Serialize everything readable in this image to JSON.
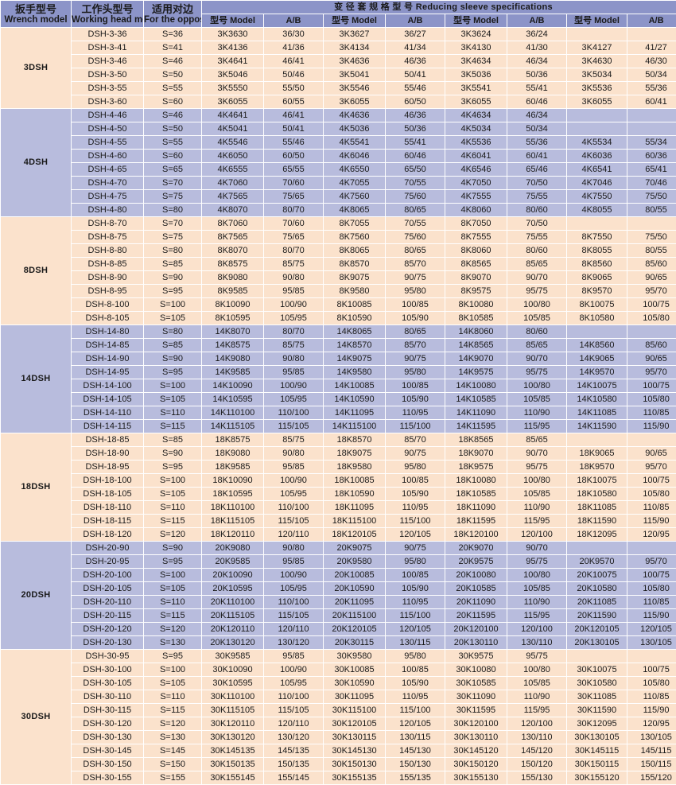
{
  "table": {
    "headers": {
      "wrench_model_cn": "扳手型号",
      "wrench_model_en": "Wrench model",
      "working_head_cn": "工作头型号",
      "working_head_en": "Working head model",
      "opposite_cn": "适用对边",
      "opposite_en": "For the opposite",
      "sleeve_group": "变 径 套 规 格 型 号  Reducing sleeve specifications",
      "model": "型号 Model",
      "ab": "A/B"
    },
    "colors": {
      "header_bg": "#8c94c8",
      "header_text": "#ffffff",
      "row_peach": "#fbe2cc",
      "row_lavender": "#b8bcdd",
      "grid": "#ffffff",
      "text": "#1a1a1a"
    },
    "groups": [
      {
        "label": "3DSH",
        "shade": "peach",
        "rows": [
          {
            "wrench": "DSH-3-36",
            "opposite": "S=36",
            "s1m": "3K3630",
            "s1ab": "36/30",
            "s2m": "3K3627",
            "s2ab": "36/27",
            "s3m": "3K3624",
            "s3ab": "36/24",
            "s4m": "",
            "s4ab": ""
          },
          {
            "wrench": "DSH-3-41",
            "opposite": "S=41",
            "s1m": "3K4136",
            "s1ab": "41/36",
            "s2m": "3K4134",
            "s2ab": "41/34",
            "s3m": "3K4130",
            "s3ab": "41/30",
            "s4m": "3K4127",
            "s4ab": "41/27"
          },
          {
            "wrench": "DSH-3-46",
            "opposite": "S=46",
            "s1m": "3K4641",
            "s1ab": "46/41",
            "s2m": "3K4636",
            "s2ab": "46/36",
            "s3m": "3K4634",
            "s3ab": "46/34",
            "s4m": "3K4630",
            "s4ab": "46/30"
          },
          {
            "wrench": "DSH-3-50",
            "opposite": "S=50",
            "s1m": "3K5046",
            "s1ab": "50/46",
            "s2m": "3K5041",
            "s2ab": "50/41",
            "s3m": "3K5036",
            "s3ab": "50/36",
            "s4m": "3K5034",
            "s4ab": "50/34"
          },
          {
            "wrench": "DSH-3-55",
            "opposite": "S=55",
            "s1m": "3K5550",
            "s1ab": "55/50",
            "s2m": "3K5546",
            "s2ab": "55/46",
            "s3m": "3K5541",
            "s3ab": "55/41",
            "s4m": "3K5536",
            "s4ab": "55/36"
          },
          {
            "wrench": "DSH-3-60",
            "opposite": "S=60",
            "s1m": "3K6055",
            "s1ab": "60/55",
            "s2m": "3K6055",
            "s2ab": "60/50",
            "s3m": "3K6055",
            "s3ab": "60/46",
            "s4m": "3K6055",
            "s4ab": "60/41"
          }
        ]
      },
      {
        "label": "4DSH",
        "shade": "lav",
        "rows": [
          {
            "wrench": "DSH-4-46",
            "opposite": "S=46",
            "s1m": "4K4641",
            "s1ab": "46/41",
            "s2m": "4K4636",
            "s2ab": "46/36",
            "s3m": "4K4634",
            "s3ab": "46/34",
            "s4m": "",
            "s4ab": ""
          },
          {
            "wrench": "DSH-4-50",
            "opposite": "S=50",
            "s1m": "4K5041",
            "s1ab": "50/41",
            "s2m": "4K5036",
            "s2ab": "50/36",
            "s3m": "4K5034",
            "s3ab": "50/34",
            "s4m": "",
            "s4ab": ""
          },
          {
            "wrench": "DSH-4-55",
            "opposite": "S=55",
            "s1m": "4K5546",
            "s1ab": "55/46",
            "s2m": "4K5541",
            "s2ab": "55/41",
            "s3m": "4K5536",
            "s3ab": "55/36",
            "s4m": "4K5534",
            "s4ab": "55/34"
          },
          {
            "wrench": "DSH-4-60",
            "opposite": "S=60",
            "s1m": "4K6050",
            "s1ab": "60/50",
            "s2m": "4K6046",
            "s2ab": "60/46",
            "s3m": "4K6041",
            "s3ab": "60/41",
            "s4m": "4K6036",
            "s4ab": "60/36"
          },
          {
            "wrench": "DSH-4-65",
            "opposite": "S=65",
            "s1m": "4K6555",
            "s1ab": "65/55",
            "s2m": "4K6550",
            "s2ab": "65/50",
            "s3m": "4K6546",
            "s3ab": "65/46",
            "s4m": "4K6541",
            "s4ab": "65/41"
          },
          {
            "wrench": "DSH-4-70",
            "opposite": "S=70",
            "s1m": "4K7060",
            "s1ab": "70/60",
            "s2m": "4K7055",
            "s2ab": "70/55",
            "s3m": "4K7050",
            "s3ab": "70/50",
            "s4m": "4K7046",
            "s4ab": "70/46"
          },
          {
            "wrench": "DSH-4-75",
            "opposite": "S=75",
            "s1m": "4K7565",
            "s1ab": "75/65",
            "s2m": "4K7560",
            "s2ab": "75/60",
            "s3m": "4K7555",
            "s3ab": "75/55",
            "s4m": "4K7550",
            "s4ab": "75/50"
          },
          {
            "wrench": "DSH-4-80",
            "opposite": "S=80",
            "s1m": "4K8070",
            "s1ab": "80/70",
            "s2m": "4K8065",
            "s2ab": "80/65",
            "s3m": "4K8060",
            "s3ab": "80/60",
            "s4m": "4K8055",
            "s4ab": "80/55"
          }
        ]
      },
      {
        "label": "8DSH",
        "shade": "peach",
        "rows": [
          {
            "wrench": "DSH-8-70",
            "opposite": "S=70",
            "s1m": "8K7060",
            "s1ab": "70/60",
            "s2m": "8K7055",
            "s2ab": "70/55",
            "s3m": "8K7050",
            "s3ab": "70/50",
            "s4m": "",
            "s4ab": ""
          },
          {
            "wrench": "DSH-8-75",
            "opposite": "S=75",
            "s1m": "8K7565",
            "s1ab": "75/65",
            "s2m": "8K7560",
            "s2ab": "75/60",
            "s3m": "8K7555",
            "s3ab": "75/55",
            "s4m": "8K7550",
            "s4ab": "75/50"
          },
          {
            "wrench": "DSH-8-80",
            "opposite": "S=80",
            "s1m": "8K8070",
            "s1ab": "80/70",
            "s2m": "8K8065",
            "s2ab": "80/65",
            "s3m": "8K8060",
            "s3ab": "80/60",
            "s4m": "8K8055",
            "s4ab": "80/55"
          },
          {
            "wrench": "DSH-8-85",
            "opposite": "S=85",
            "s1m": "8K8575",
            "s1ab": "85/75",
            "s2m": "8K8570",
            "s2ab": "85/70",
            "s3m": "8K8565",
            "s3ab": "85/65",
            "s4m": "8K8560",
            "s4ab": "85/60"
          },
          {
            "wrench": "DSH-8-90",
            "opposite": "S=90",
            "s1m": "8K9080",
            "s1ab": "90/80",
            "s2m": "8K9075",
            "s2ab": "90/75",
            "s3m": "8K9070",
            "s3ab": "90/70",
            "s4m": "8K9065",
            "s4ab": "90/65"
          },
          {
            "wrench": "DSH-8-95",
            "opposite": "S=95",
            "s1m": "8K9585",
            "s1ab": "95/85",
            "s2m": "8K9580",
            "s2ab": "95/80",
            "s3m": "8K9575",
            "s3ab": "95/75",
            "s4m": "8K9570",
            "s4ab": "95/70"
          },
          {
            "wrench": "DSH-8-100",
            "opposite": "S=100",
            "s1m": "8K10090",
            "s1ab": "100/90",
            "s2m": "8K10085",
            "s2ab": "100/85",
            "s3m": "8K10080",
            "s3ab": "100/80",
            "s4m": "8K10075",
            "s4ab": "100/75"
          },
          {
            "wrench": "DSH-8-105",
            "opposite": "S=105",
            "s1m": "8K10595",
            "s1ab": "105/95",
            "s2m": "8K10590",
            "s2ab": "105/90",
            "s3m": "8K10585",
            "s3ab": "105/85",
            "s4m": "8K10580",
            "s4ab": "105/80"
          }
        ]
      },
      {
        "label": "14DSH",
        "shade": "lav",
        "rows": [
          {
            "wrench": "DSH-14-80",
            "opposite": "S=80",
            "s1m": "14K8070",
            "s1ab": "80/70",
            "s2m": "14K8065",
            "s2ab": "80/65",
            "s3m": "14K8060",
            "s3ab": "80/60",
            "s4m": "",
            "s4ab": ""
          },
          {
            "wrench": "DSH-14-85",
            "opposite": "S=85",
            "s1m": "14K8575",
            "s1ab": "85/75",
            "s2m": "14K8570",
            "s2ab": "85/70",
            "s3m": "14K8565",
            "s3ab": "85/65",
            "s4m": "14K8560",
            "s4ab": "85/60"
          },
          {
            "wrench": "DSH-14-90",
            "opposite": "S=90",
            "s1m": "14K9080",
            "s1ab": "90/80",
            "s2m": "14K9075",
            "s2ab": "90/75",
            "s3m": "14K9070",
            "s3ab": "90/70",
            "s4m": "14K9065",
            "s4ab": "90/65"
          },
          {
            "wrench": "DSH-14-95",
            "opposite": "S=95",
            "s1m": "14K9585",
            "s1ab": "95/85",
            "s2m": "14K9580",
            "s2ab": "95/80",
            "s3m": "14K9575",
            "s3ab": "95/75",
            "s4m": "14K9570",
            "s4ab": "95/70"
          },
          {
            "wrench": "DSH-14-100",
            "opposite": "S=100",
            "s1m": "14K10090",
            "s1ab": "100/90",
            "s2m": "14K10085",
            "s2ab": "100/85",
            "s3m": "14K10080",
            "s3ab": "100/80",
            "s4m": "14K10075",
            "s4ab": "100/75"
          },
          {
            "wrench": "DSH-14-105",
            "opposite": "S=105",
            "s1m": "14K10595",
            "s1ab": "105/95",
            "s2m": "14K10590",
            "s2ab": "105/90",
            "s3m": "14K10585",
            "s3ab": "105/85",
            "s4m": "14K10580",
            "s4ab": "105/80"
          },
          {
            "wrench": "DSH-14-110",
            "opposite": "S=110",
            "s1m": "14K110100",
            "s1ab": "110/100",
            "s2m": "14K11095",
            "s2ab": "110/95",
            "s3m": "14K11090",
            "s3ab": "110/90",
            "s4m": "14K11085",
            "s4ab": "110/85"
          },
          {
            "wrench": "DSH-14-115",
            "opposite": "S=115",
            "s1m": "14K115105",
            "s1ab": "115/105",
            "s2m": "14K115100",
            "s2ab": "115/100",
            "s3m": "14K11595",
            "s3ab": "115/95",
            "s4m": "14K11590",
            "s4ab": "115/90"
          }
        ]
      },
      {
        "label": "18DSH",
        "shade": "peach",
        "rows": [
          {
            "wrench": "DSH-18-85",
            "opposite": "S=85",
            "s1m": "18K8575",
            "s1ab": "85/75",
            "s2m": "18K8570",
            "s2ab": "85/70",
            "s3m": "18K8565",
            "s3ab": "85/65",
            "s4m": "",
            "s4ab": ""
          },
          {
            "wrench": "DSH-18-90",
            "opposite": "S=90",
            "s1m": "18K9080",
            "s1ab": "90/80",
            "s2m": "18K9075",
            "s2ab": "90/75",
            "s3m": "18K9070",
            "s3ab": "90/70",
            "s4m": "18K9065",
            "s4ab": "90/65"
          },
          {
            "wrench": "DSH-18-95",
            "opposite": "S=95",
            "s1m": "18K9585",
            "s1ab": "95/85",
            "s2m": "18K9580",
            "s2ab": "95/80",
            "s3m": "18K9575",
            "s3ab": "95/75",
            "s4m": "18K9570",
            "s4ab": "95/70"
          },
          {
            "wrench": "DSH-18-100",
            "opposite": "S=100",
            "s1m": "18K10090",
            "s1ab": "100/90",
            "s2m": "18K10085",
            "s2ab": "100/85",
            "s3m": "18K10080",
            "s3ab": "100/80",
            "s4m": "18K10075",
            "s4ab": "100/75"
          },
          {
            "wrench": "DSH-18-105",
            "opposite": "S=105",
            "s1m": "18K10595",
            "s1ab": "105/95",
            "s2m": "18K10590",
            "s2ab": "105/90",
            "s3m": "18K10585",
            "s3ab": "105/85",
            "s4m": "18K10580",
            "s4ab": "105/80"
          },
          {
            "wrench": "DSH-18-110",
            "opposite": "S=110",
            "s1m": "18K110100",
            "s1ab": "110/100",
            "s2m": "18K11095",
            "s2ab": "110/95",
            "s3m": "18K11090",
            "s3ab": "110/90",
            "s4m": "18K11085",
            "s4ab": "110/85"
          },
          {
            "wrench": "DSH-18-115",
            "opposite": "S=115",
            "s1m": "18K115105",
            "s1ab": "115/105",
            "s2m": "18K115100",
            "s2ab": "115/100",
            "s3m": "18K11595",
            "s3ab": "115/95",
            "s4m": "18K11590",
            "s4ab": "115/90"
          },
          {
            "wrench": "DSH-18-120",
            "opposite": "S=120",
            "s1m": "18K120110",
            "s1ab": "120/110",
            "s2m": "18K120105",
            "s2ab": "120/105",
            "s3m": "18K120100",
            "s3ab": "120/100",
            "s4m": "18K12095",
            "s4ab": "120/95"
          }
        ]
      },
      {
        "label": "20DSH",
        "shade": "lav",
        "rows": [
          {
            "wrench": "DSH-20-90",
            "opposite": "S=90",
            "s1m": "20K9080",
            "s1ab": "90/80",
            "s2m": "20K9075",
            "s2ab": "90/75",
            "s3m": "20K9070",
            "s3ab": "90/70",
            "s4m": "",
            "s4ab": ""
          },
          {
            "wrench": "DSH-20-95",
            "opposite": "S=95",
            "s1m": "20K9585",
            "s1ab": "95/85",
            "s2m": "20K9580",
            "s2ab": "95/80",
            "s3m": "20K9575",
            "s3ab": "95/75",
            "s4m": "20K9570",
            "s4ab": "95/70"
          },
          {
            "wrench": "DSH-20-100",
            "opposite": "S=100",
            "s1m": "20K10090",
            "s1ab": "100/90",
            "s2m": "20K10085",
            "s2ab": "100/85",
            "s3m": "20K10080",
            "s3ab": "100/80",
            "s4m": "20K10075",
            "s4ab": "100/75"
          },
          {
            "wrench": "DSH-20-105",
            "opposite": "S=105",
            "s1m": "20K10595",
            "s1ab": "105/95",
            "s2m": "20K10590",
            "s2ab": "105/90",
            "s3m": "20K10585",
            "s3ab": "105/85",
            "s4m": "20K10580",
            "s4ab": "105/80"
          },
          {
            "wrench": "DSH-20-110",
            "opposite": "S=110",
            "s1m": "20K110100",
            "s1ab": "110/100",
            "s2m": "20K11095",
            "s2ab": "110/95",
            "s3m": "20K11090",
            "s3ab": "110/90",
            "s4m": "20K11085",
            "s4ab": "110/85"
          },
          {
            "wrench": "DSH-20-115",
            "opposite": "S=115",
            "s1m": "20K115105",
            "s1ab": "115/105",
            "s2m": "20K115100",
            "s2ab": "115/100",
            "s3m": "20K11595",
            "s3ab": "115/95",
            "s4m": "20K11590",
            "s4ab": "115/90"
          },
          {
            "wrench": "DSH-20-120",
            "opposite": "S=120",
            "s1m": "20K120110",
            "s1ab": "120/110",
            "s2m": "20K120105",
            "s2ab": "120/105",
            "s3m": "20K120100",
            "s3ab": "120/100",
            "s4m": "20K120105",
            "s4ab": "120/105"
          },
          {
            "wrench": "DSH-20-130",
            "opposite": "S=130",
            "s1m": "20K130120",
            "s1ab": "130/120",
            "s2m": "20K30115",
            "s2ab": "130/115",
            "s3m": "20K130110",
            "s3ab": "130/110",
            "s4m": "20K130105",
            "s4ab": "130/105"
          }
        ]
      },
      {
        "label": "30DSH",
        "shade": "peach",
        "rows": [
          {
            "wrench": "DSH-30-95",
            "opposite": "S=95",
            "s1m": "30K9585",
            "s1ab": "95/85",
            "s2m": "30K9580",
            "s2ab": "95/80",
            "s3m": "30K9575",
            "s3ab": "95/75",
            "s4m": "",
            "s4ab": ""
          },
          {
            "wrench": "DSH-30-100",
            "opposite": "S=100",
            "s1m": "30K10090",
            "s1ab": "100/90",
            "s2m": "30K10085",
            "s2ab": "100/85",
            "s3m": "30K10080",
            "s3ab": "100/80",
            "s4m": "30K10075",
            "s4ab": "100/75"
          },
          {
            "wrench": "DSH-30-105",
            "opposite": "S=105",
            "s1m": "30K10595",
            "s1ab": "105/95",
            "s2m": "30K10590",
            "s2ab": "105/90",
            "s3m": "30K10585",
            "s3ab": "105/85",
            "s4m": "30K10580",
            "s4ab": "105/80"
          },
          {
            "wrench": "DSH-30-110",
            "opposite": "S=110",
            "s1m": "30K110100",
            "s1ab": "110/100",
            "s2m": "30K11095",
            "s2ab": "110/95",
            "s3m": "30K11090",
            "s3ab": "110/90",
            "s4m": "30K11085",
            "s4ab": "110/85"
          },
          {
            "wrench": "DSH-30-115",
            "opposite": "S=115",
            "s1m": "30K115105",
            "s1ab": "115/105",
            "s2m": "30K115100",
            "s2ab": "115/100",
            "s3m": "30K11595",
            "s3ab": "115/95",
            "s4m": "30K11590",
            "s4ab": "115/90"
          },
          {
            "wrench": "DSH-30-120",
            "opposite": "S=120",
            "s1m": "30K120110",
            "s1ab": "120/110",
            "s2m": "30K120105",
            "s2ab": "120/105",
            "s3m": "30K120100",
            "s3ab": "120/100",
            "s4m": "30K12095",
            "s4ab": "120/95"
          },
          {
            "wrench": "DSH-30-130",
            "opposite": "S=130",
            "s1m": "30K130120",
            "s1ab": "130/120",
            "s2m": "30K130115",
            "s2ab": "130/115",
            "s3m": "30K130110",
            "s3ab": "130/110",
            "s4m": "30K130105",
            "s4ab": "130/105"
          },
          {
            "wrench": "DSH-30-145",
            "opposite": "S=145",
            "s1m": "30K145135",
            "s1ab": "145/135",
            "s2m": "30K145130",
            "s2ab": "145/130",
            "s3m": "30K145120",
            "s3ab": "145/120",
            "s4m": "30K145115",
            "s4ab": "145/115"
          },
          {
            "wrench": "DSH-30-150",
            "opposite": "S=150",
            "s1m": "30K150135",
            "s1ab": "150/135",
            "s2m": "30K150130",
            "s2ab": "150/130",
            "s3m": "30K150120",
            "s3ab": "150/120",
            "s4m": "30K150115",
            "s4ab": "150/115"
          },
          {
            "wrench": "DSH-30-155",
            "opposite": "S=155",
            "s1m": "30K155145",
            "s1ab": "155/145",
            "s2m": "30K155135",
            "s2ab": "155/135",
            "s3m": "30K155130",
            "s3ab": "155/130",
            "s4m": "30K155120",
            "s4ab": "155/120"
          }
        ]
      }
    ]
  }
}
